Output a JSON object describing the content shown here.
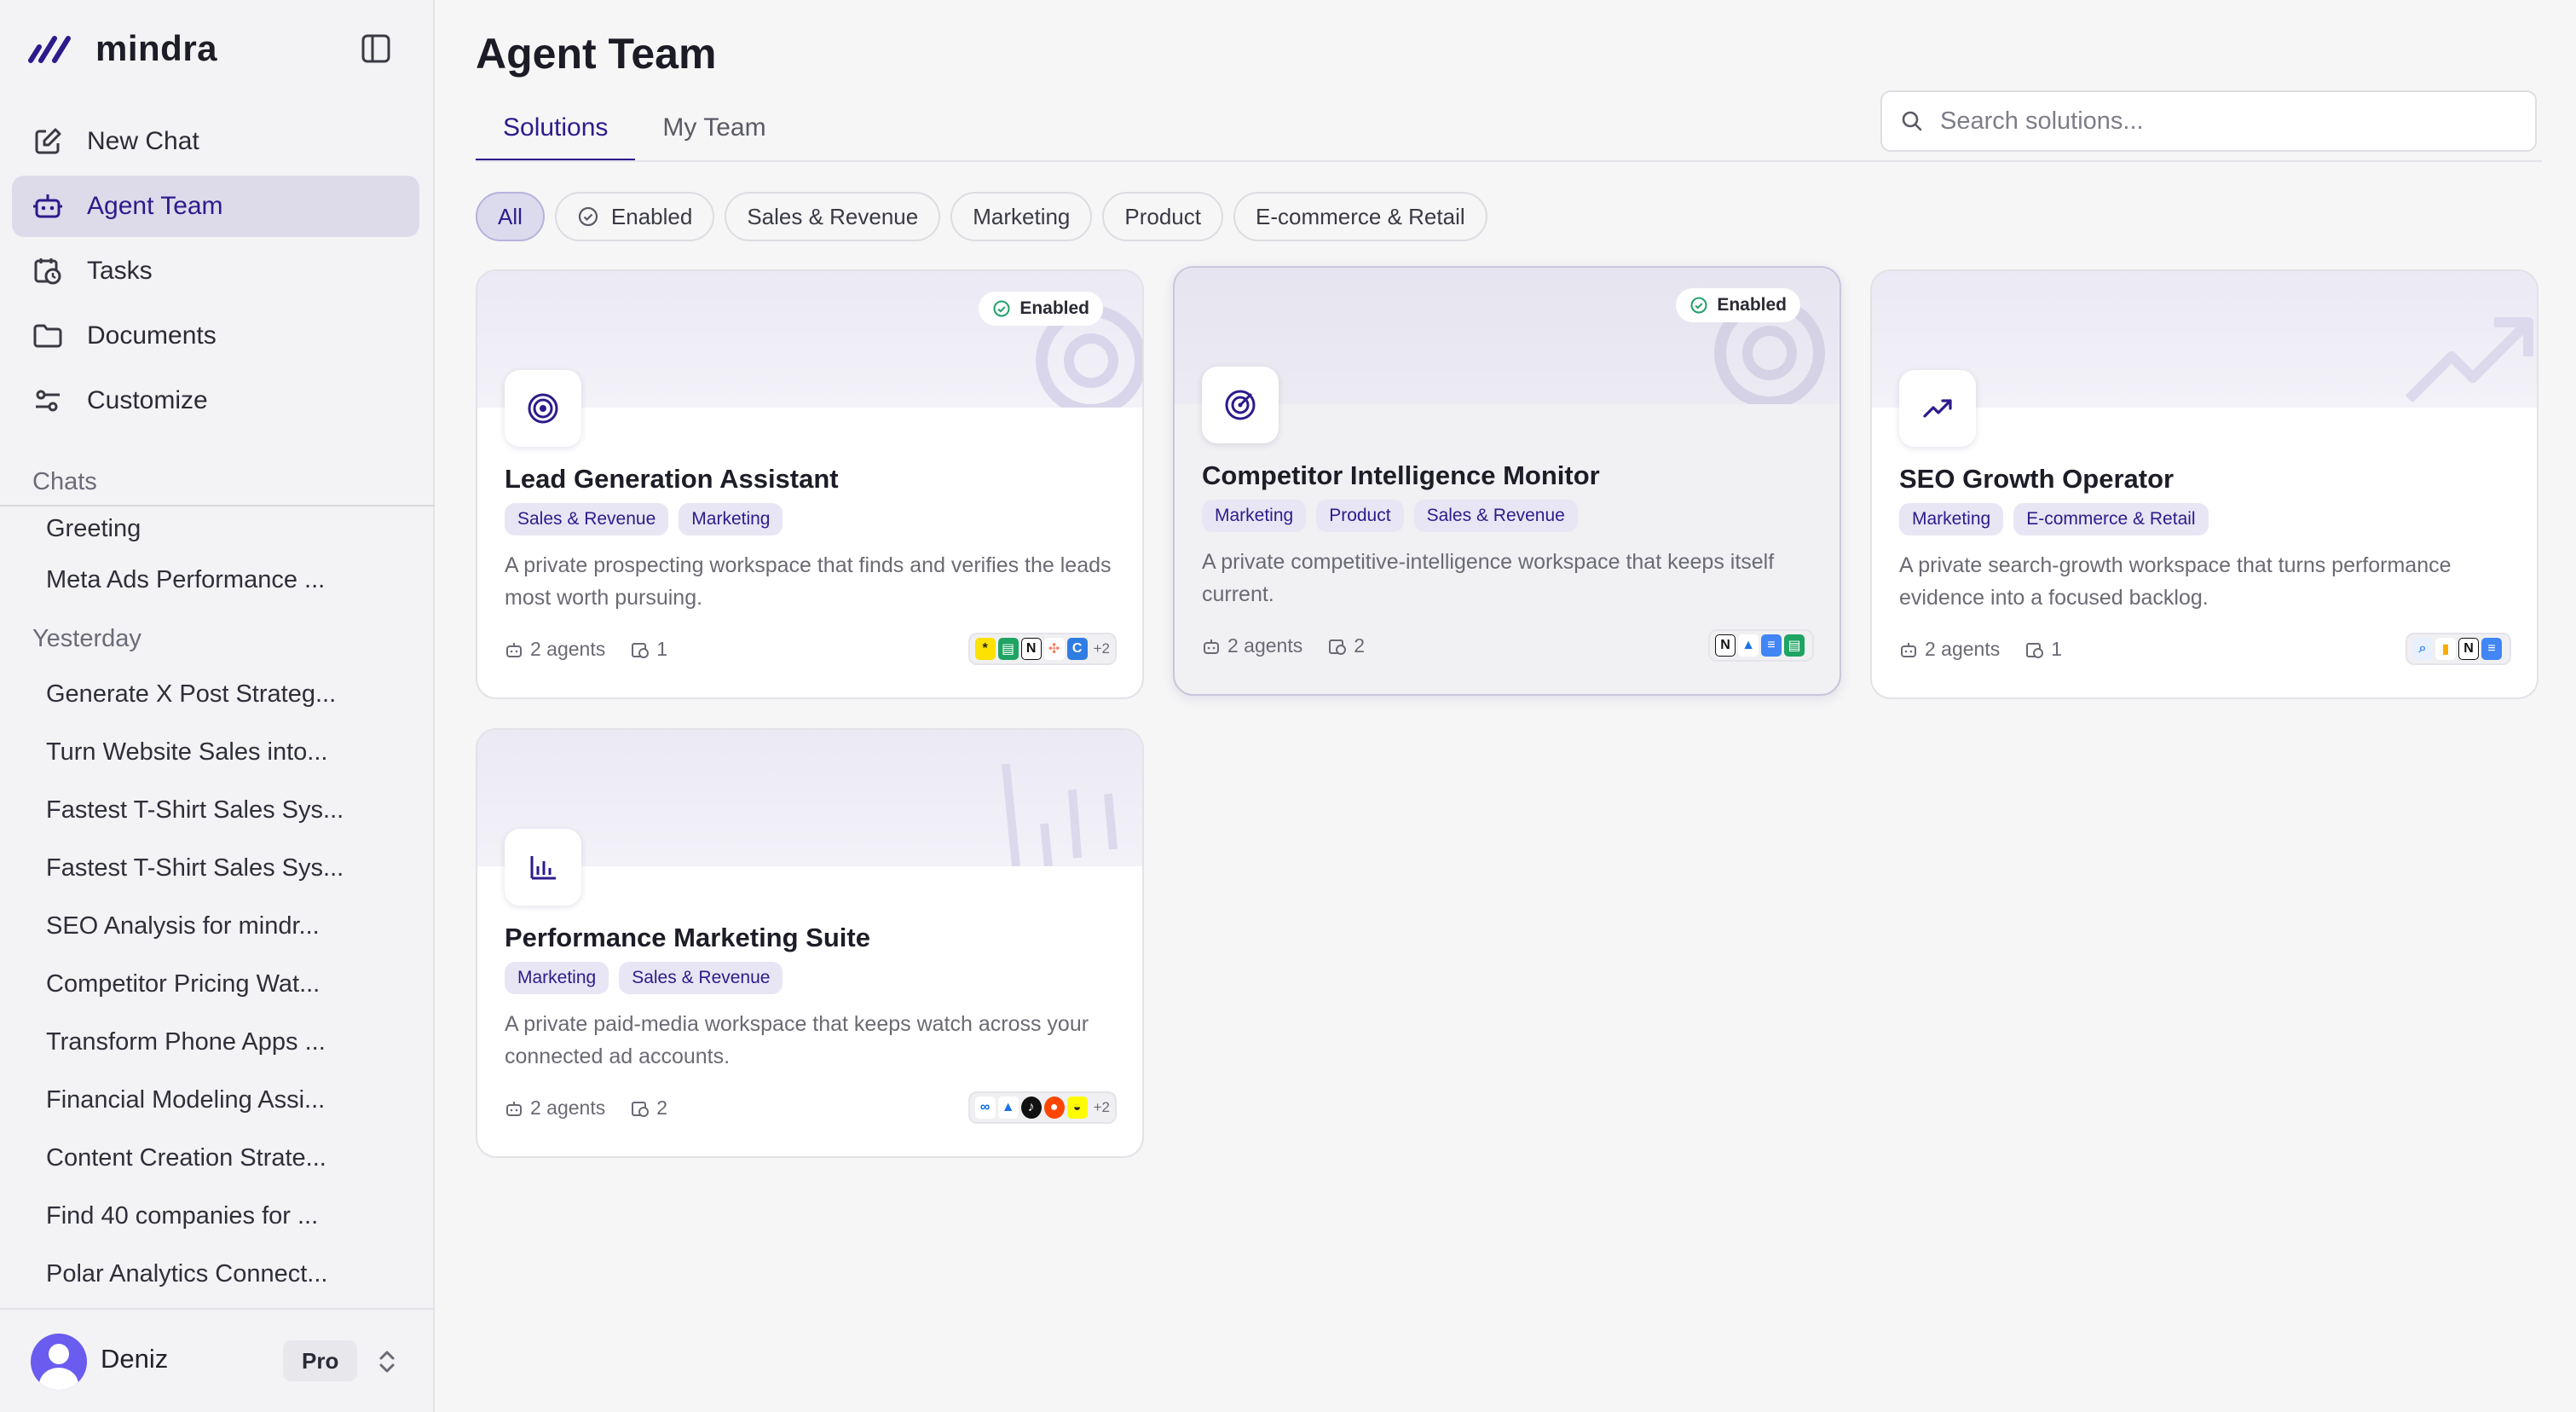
{
  "brand": {
    "name": "mindra"
  },
  "nav": [
    {
      "label": "New Chat",
      "icon": "edit-icon"
    },
    {
      "label": "Agent Team",
      "icon": "robot-icon"
    },
    {
      "label": "Tasks",
      "icon": "calendar-clock-icon"
    },
    {
      "label": "Documents",
      "icon": "folder-icon"
    },
    {
      "label": "Customize",
      "icon": "sliders-icon"
    }
  ],
  "chats": {
    "section_label": "Chats",
    "recent": [
      "Greeting",
      "Meta Ads Performance ..."
    ],
    "yesterday_label": "Yesterday",
    "yesterday": [
      "Generate X Post Strateg...",
      "Turn Website Sales into...",
      "Fastest T-Shirt Sales Sys...",
      "Fastest T-Shirt Sales Sys...",
      "SEO Analysis for mindr...",
      "Competitor Pricing Wat...",
      "Transform Phone Apps ...",
      "Financial Modeling Assi...",
      "Content Creation Strate...",
      "Find 40 companies for ...",
      "Polar Analytics Connect..."
    ]
  },
  "user": {
    "name": "Deniz",
    "plan": "Pro"
  },
  "page": {
    "title": "Agent Team",
    "tabs": [
      "Solutions",
      "My Team"
    ],
    "search_placeholder": "Search solutions...",
    "filters": [
      "All",
      "Enabled",
      "Sales & Revenue",
      "Marketing",
      "Product",
      "E-commerce & Retail"
    ]
  },
  "cards": [
    {
      "title": "Lead Generation Assistant",
      "enabled": true,
      "enabled_label": "Enabled",
      "icon": "target-icon",
      "tags": [
        "Sales & Revenue",
        "Marketing"
      ],
      "description": "A private prospecting workspace that finds and verifies the leads most worth pursuing.",
      "agents": "2 agents",
      "tasks": "1",
      "integrations": [
        "asterisk",
        "sheets",
        "notion",
        "hubspot",
        "clearbit"
      ],
      "integrations_more": "+2"
    },
    {
      "title": "Competitor Intelligence Monitor",
      "enabled": true,
      "enabled_label": "Enabled",
      "icon": "radar-icon",
      "tags": [
        "Marketing",
        "Product",
        "Sales & Revenue"
      ],
      "description": "A private competitive-intelligence workspace that keeps itself current.",
      "agents": "2 agents",
      "tasks": "2",
      "integrations": [
        "notion",
        "drive",
        "docs",
        "sheets"
      ],
      "integrations_more": ""
    },
    {
      "title": "SEO Growth Operator",
      "enabled": false,
      "enabled_label": "",
      "icon": "trend-up-icon",
      "tags": [
        "Marketing",
        "E-commerce & Retail"
      ],
      "description": "A private search-growth workspace that turns performance evidence into a focused backlog.",
      "agents": "2 agents",
      "tasks": "1",
      "integrations": [
        "search-console",
        "analytics",
        "notion",
        "docs"
      ],
      "integrations_more": ""
    },
    {
      "title": "Performance Marketing Suite",
      "enabled": false,
      "enabled_label": "",
      "icon": "bar-chart-icon",
      "tags": [
        "Marketing",
        "Sales & Revenue"
      ],
      "description": "A private paid-media workspace that keeps watch across your connected ad accounts.",
      "agents": "2 agents",
      "tasks": "2",
      "integrations": [
        "meta",
        "google-ads",
        "tiktok",
        "reddit",
        "snapchat"
      ],
      "integrations_more": "+2"
    }
  ],
  "colors": {
    "accent": "#2d1b8c",
    "accent_bg": "#dddbea",
    "enabled_green": "#22a06b"
  }
}
